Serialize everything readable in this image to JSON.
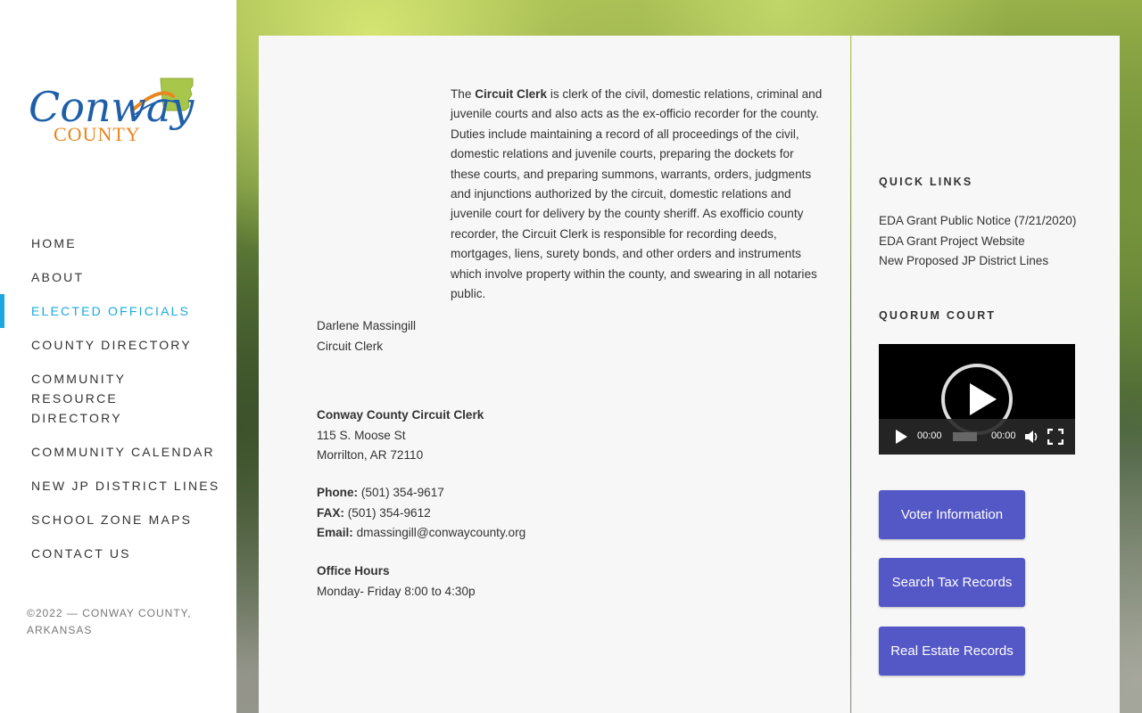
{
  "site": {
    "logo_line1": "Conway",
    "logo_line2": "COUNTY"
  },
  "nav": {
    "items": [
      {
        "label": "HOME",
        "active": false
      },
      {
        "label": "ABOUT",
        "active": false
      },
      {
        "label": "ELECTED OFFICIALS",
        "active": true
      },
      {
        "label": "COUNTY DIRECTORY",
        "active": false
      },
      {
        "label": "COMMUNITY RESOURCE DIRECTORY",
        "active": false
      },
      {
        "label": "COMMUNITY CALENDAR",
        "active": false
      },
      {
        "label": "NEW JP DISTRICT LINES",
        "active": false
      },
      {
        "label": "SCHOOL ZONE MAPS",
        "active": false
      },
      {
        "label": "CONTACT US",
        "active": false
      }
    ]
  },
  "footer": {
    "copyright": "©2022 — CONWAY COUNTY, ARKANSAS"
  },
  "main": {
    "intro_pre": "The ",
    "intro_bold": "Circuit Clerk",
    "intro_post": " is clerk of the civil, domestic relations, criminal and juvenile courts and also acts as the ex-officio recorder for the county. Duties include maintaining a record of all proceedings of the civil, domestic relations and juvenile courts, preparing the dockets for these courts, and preparing summons, warrants, orders, judgments and injunctions authorized by the circuit, domestic relations and juvenile court for delivery by the county sheriff. As exofficio county recorder, the Circuit Clerk is responsible for recording deeds, mortgages, liens, surety bonds, and other orders and instruments which involve property within the county, and swearing in all notaries public.",
    "official_name": "Darlene Massingill",
    "official_title": "Circuit Clerk",
    "office_name": "Conway County Circuit Clerk",
    "address_line1": "115 S. Moose St",
    "address_line2": "Morrilton, AR 72110",
    "phone_label": "Phone:",
    "phone": "(501) 354-9617",
    "fax_label": "FAX:",
    "fax": "(501) 354-9612",
    "email_label": "Email:",
    "email": "dmassingill@conwaycounty.org",
    "hours_label": "Office Hours",
    "hours": "Monday- Friday 8:00 to 4:30p"
  },
  "widgets": {
    "quick_links_title": "QUICK LINKS",
    "quick_links": [
      "EDA Grant Public Notice (7/21/2020)",
      "EDA Grant Project Website",
      "New Proposed JP District Lines"
    ],
    "quorum_title": "QUORUM COURT",
    "video": {
      "current_time": "00:00",
      "duration": "00:00"
    },
    "buttons": {
      "voter": "Voter Information",
      "tax": "Search Tax Records",
      "real_estate": "Real Estate Records"
    }
  },
  "colors": {
    "accent": "#1aa8e0",
    "button": "#5457c6",
    "logo_blue": "#1f5fa8",
    "logo_orange": "#e8861f",
    "logo_green": "#9cc34a"
  }
}
